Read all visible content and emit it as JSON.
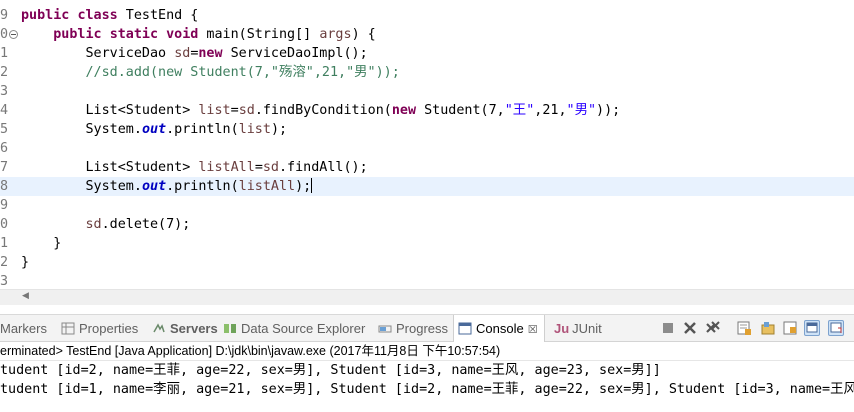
{
  "editor": {
    "lines": [
      {
        "ln": "9",
        "tokens": [
          [
            "kw",
            "public"
          ],
          [
            "t",
            " "
          ],
          [
            "kw",
            "class"
          ],
          [
            "t",
            " TestEnd {"
          ]
        ]
      },
      {
        "ln": "0",
        "fold": true,
        "tokens": [
          [
            "t",
            "    "
          ],
          [
            "kw",
            "public"
          ],
          [
            "t",
            " "
          ],
          [
            "kw",
            "static"
          ],
          [
            "t",
            " "
          ],
          [
            "kw",
            "void"
          ],
          [
            "t",
            " main(String[] "
          ],
          [
            "var",
            "args"
          ],
          [
            "t",
            ") {"
          ]
        ]
      },
      {
        "ln": "1",
        "tokens": [
          [
            "t",
            "        ServiceDao "
          ],
          [
            "var",
            "sd"
          ],
          [
            "t",
            "="
          ],
          [
            "kw",
            "new"
          ],
          [
            "t",
            " ServiceDaoImpl();"
          ]
        ]
      },
      {
        "ln": "2",
        "tokens": [
          [
            "cm",
            "        //sd.add(new Student(7,\"殇溶\",21,\"男\"));"
          ]
        ]
      },
      {
        "ln": "3",
        "tokens": []
      },
      {
        "ln": "4",
        "tokens": [
          [
            "t",
            "        List<Student> "
          ],
          [
            "var",
            "list"
          ],
          [
            "t",
            "="
          ],
          [
            "var",
            "sd"
          ],
          [
            "t",
            ".findByCondition("
          ],
          [
            "kw",
            "new"
          ],
          [
            "t",
            " Student(7,"
          ],
          [
            "str",
            "\"王\""
          ],
          [
            "t",
            ",21,"
          ],
          [
            "str",
            "\"男\""
          ],
          [
            "t",
            "));"
          ]
        ]
      },
      {
        "ln": "5",
        "tokens": [
          [
            "t",
            "        System."
          ],
          [
            "fld",
            "out"
          ],
          [
            "t",
            ".println("
          ],
          [
            "var",
            "list"
          ],
          [
            "t",
            ");"
          ]
        ]
      },
      {
        "ln": "6",
        "tokens": []
      },
      {
        "ln": "7",
        "tokens": [
          [
            "t",
            "        List<Student> "
          ],
          [
            "var",
            "listAll"
          ],
          [
            "t",
            "="
          ],
          [
            "var",
            "sd"
          ],
          [
            "t",
            ".findAll();"
          ]
        ]
      },
      {
        "ln": "8",
        "current": true,
        "tokens": [
          [
            "t",
            "        System."
          ],
          [
            "fld",
            "out"
          ],
          [
            "t",
            ".println("
          ],
          [
            "var",
            "listAll"
          ],
          [
            "t",
            ");"
          ]
        ]
      },
      {
        "ln": "9",
        "tokens": []
      },
      {
        "ln": "0",
        "tokens": [
          [
            "t",
            "        "
          ],
          [
            "var",
            "sd"
          ],
          [
            "t",
            ".delete(7);"
          ]
        ]
      },
      {
        "ln": "1",
        "tokens": [
          [
            "t",
            "    }"
          ]
        ]
      },
      {
        "ln": "2",
        "tokens": [
          [
            "t",
            "}"
          ]
        ]
      },
      {
        "ln": "3",
        "tokens": []
      }
    ]
  },
  "tabs": [
    {
      "label": "Markers",
      "icon": "markers-icon"
    },
    {
      "label": "Properties",
      "icon": "properties-icon"
    },
    {
      "label": "Servers",
      "icon": "servers-icon"
    },
    {
      "label": "Data Source Explorer",
      "icon": "data-source-icon"
    },
    {
      "label": "Progress",
      "icon": "progress-icon"
    },
    {
      "label": "Console",
      "icon": "console-icon",
      "active": true,
      "close": "☒"
    },
    {
      "label": "JUnit",
      "icon": "junit-icon",
      "prefix": "Ju"
    }
  ],
  "toolbar": [
    "terminate-icon",
    "remove-launch-icon",
    "remove-all-icon",
    "scroll-lock-icon",
    "pin-console-icon",
    "word-wrap-icon",
    "display-console-icon",
    "open-console-icon"
  ],
  "console": {
    "status": "erminated> TestEnd [Java Application] D:\\jdk\\bin\\javaw.exe (2017年11月8日 下午10:57:54)",
    "output": [
      "tudent [id=2, name=王菲, age=22, sex=男], Student [id=3, name=王风, age=23, sex=男]]",
      "tudent [id=1, name=李丽, age=21, sex=男], Student [id=2, name=王菲, age=22, sex=男], Student [id=3, name=王风"
    ]
  },
  "colors": {
    "keyword": "#7f0055",
    "string": "#2a00ff",
    "comment": "#3f7f5f",
    "variable": "#6a3e3e",
    "field": "#0000c0",
    "current_line": "#e8f2fe"
  }
}
